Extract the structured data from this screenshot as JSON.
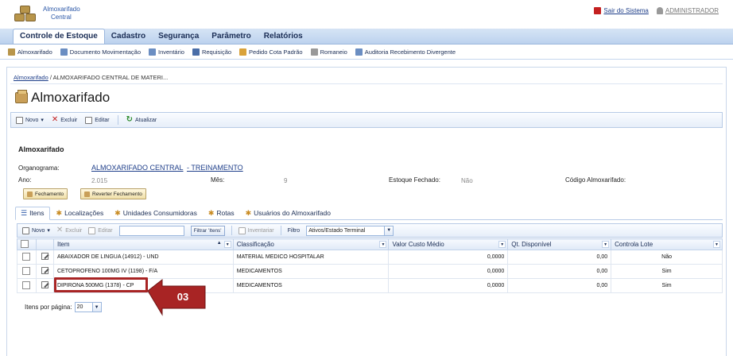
{
  "header": {
    "logo_line1": "Almoxarifado",
    "logo_line2": "Central",
    "logout_label": "Sair do Sistema",
    "user_label": "ADMINISTRADOR"
  },
  "mainnav": [
    "Controle de Estoque",
    "Cadastro",
    "Segurança",
    "Parâmetro",
    "Relatórios"
  ],
  "subnav": [
    {
      "label": "Almoxarifado",
      "icon": "box-icon",
      "color": "#b8954a"
    },
    {
      "label": "Documento Movimentação",
      "icon": "document-icon",
      "color": "#6b8ec2"
    },
    {
      "label": "Inventário",
      "icon": "inventory-icon",
      "color": "#6b8ec2"
    },
    {
      "label": "Requisição",
      "icon": "request-icon",
      "color": "#4a6ea8"
    },
    {
      "label": "Pedido Cota Padrão",
      "icon": "order-icon",
      "color": "#d9a23a"
    },
    {
      "label": "Romaneio",
      "icon": "shipping-icon",
      "color": "#999999"
    },
    {
      "label": "Auditoria Recebimento Divergente",
      "icon": "audit-icon",
      "color": "#6b8ec2"
    }
  ],
  "breadcrumb": {
    "link": "Almoxarifado",
    "rest": " / ALMOXARIFADO CENTRAL DE MATERI..."
  },
  "page_title": "Almoxarifado",
  "toolbar": {
    "new": "Novo",
    "delete": "Excluir",
    "edit": "Editar",
    "refresh": "Atualizar"
  },
  "form": {
    "section_title": "Almoxarifado",
    "org_label": "Organograma:",
    "org_value1": "ALMOXARIFADO CENTRAL",
    "org_value2": "- TREINAMENTO",
    "year_label": "Ano:",
    "year_value": "2.015",
    "month_label": "Mês:",
    "month_value": "9",
    "closed_label": "Estoque Fechado:",
    "closed_value": "Não",
    "code_label": "Código Almoxarifado:",
    "btn_close": "Fechamento",
    "btn_revert": "Reverter Fechamento"
  },
  "tabs": [
    "Itens",
    "Localizações",
    "Unidades Consumidoras",
    "Rotas",
    "Usuários do Almoxarifado"
  ],
  "grid_toolbar": {
    "new": "Novo",
    "delete": "Excluir",
    "edit": "Editar",
    "filter_btn": "Filtrar 'Itens'",
    "inventory": "Inventariar",
    "filter_label": "Filtro",
    "filter_value": "Ativos/Estado Terminal"
  },
  "grid": {
    "columns": [
      "Item",
      "Classificação",
      "Valor Custo Médio",
      "Qt. Disponível",
      "Controla Lote"
    ],
    "rows": [
      {
        "item": "ABAIXADOR DE LINGUA (14912) - UND",
        "class": "MATERIAL MEDICO HOSPITALAR",
        "cost": "0,0000",
        "qty": "0,00",
        "lot": "Não"
      },
      {
        "item": "CETOPROFENO 100MG IV (1198) - F/A",
        "class": "MEDICAMENTOS",
        "cost": "0,0000",
        "qty": "0,00",
        "lot": "Sim"
      },
      {
        "item": "DIPIRONA 500MG (1378) - CP",
        "class": "MEDICAMENTOS",
        "cost": "0,0000",
        "qty": "0,00",
        "lot": "Sim"
      }
    ]
  },
  "pager": {
    "label": "Itens por página:",
    "value": "20"
  },
  "callout": {
    "number": "03",
    "color": "#a82424"
  }
}
